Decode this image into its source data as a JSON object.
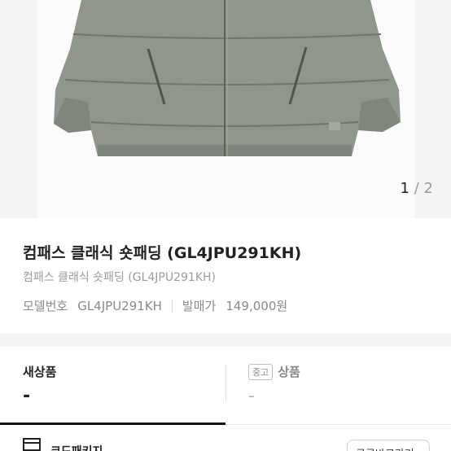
{
  "gallery": {
    "current": "1",
    "separator": "/",
    "total": "2"
  },
  "product": {
    "title": "컴패스 클래식 숏패딩 (GL4JPU291KH)",
    "subtitle": "컴패스 클래식 숏패딩 (GL4JPU291KH)",
    "model_label": "모델번호",
    "model_value": "GL4JPU291KH",
    "release_label": "발매가",
    "release_value": "149,000원"
  },
  "tabs": {
    "new": {
      "label": "새상품",
      "value": "-"
    },
    "used": {
      "badge": "중고",
      "label": "상품",
      "value": "-"
    }
  },
  "bottom": {
    "text": "코드패키지",
    "button": "구글바로가기"
  },
  "colors": {
    "jacket": "#8f968c",
    "jacket_dark": "#6f766d",
    "background": "#f4f4f4"
  },
  "icons": {
    "bottom_icon": "package-icon"
  }
}
